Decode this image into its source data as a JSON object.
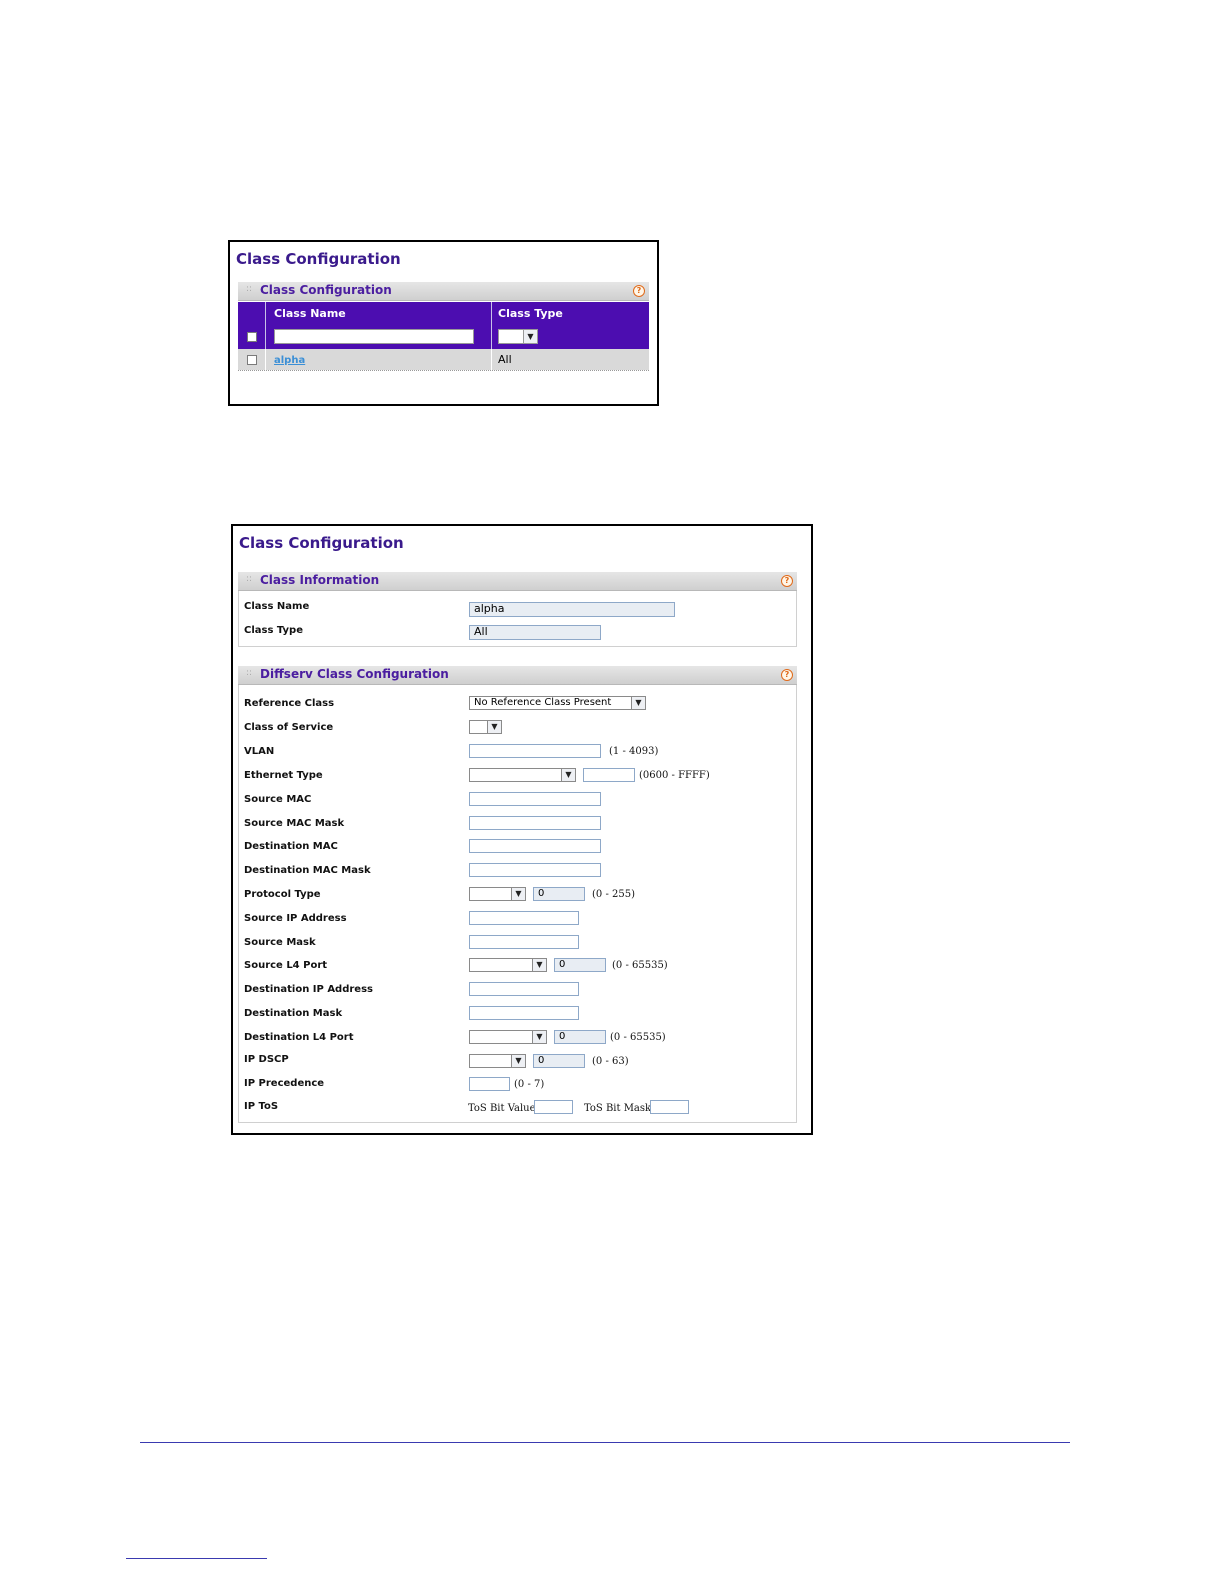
{
  "screen1": {
    "title": "Class Configuration",
    "section_title": "Class Configuration",
    "help": "?",
    "table": {
      "headers": [
        "Class Name",
        "Class Type"
      ],
      "rows": [
        {
          "name": "alpha",
          "type": "All"
        }
      ]
    }
  },
  "screen2": {
    "title": "Class Configuration",
    "help": "?",
    "info": {
      "section_title": "Class Information",
      "class_name_label": "Class Name",
      "class_name_value": "alpha",
      "class_type_label": "Class Type",
      "class_type_value": "All"
    },
    "diffserv": {
      "section_title": "Diffserv Class Configuration",
      "reference_class": {
        "label": "Reference Class",
        "value": "No Reference Class Present"
      },
      "class_of_service": {
        "label": "Class of Service"
      },
      "vlan": {
        "label": "VLAN",
        "range": "(1 - 4093)"
      },
      "ethernet_type": {
        "label": "Ethernet Type",
        "range": "(0600 - FFFF)"
      },
      "source_mac": {
        "label": "Source MAC"
      },
      "source_mac_mask": {
        "label": "Source MAC Mask"
      },
      "destination_mac": {
        "label": "Destination MAC"
      },
      "destination_mac_mask": {
        "label": "Destination MAC Mask"
      },
      "protocol_type": {
        "label": "Protocol Type",
        "value": "0",
        "range": "(0 - 255)"
      },
      "source_ip": {
        "label": "Source IP Address"
      },
      "source_mask": {
        "label": "Source Mask"
      },
      "source_l4_port": {
        "label": "Source L4 Port",
        "value": "0",
        "range": "(0 - 65535)"
      },
      "destination_ip": {
        "label": "Destination IP Address"
      },
      "destination_mask": {
        "label": "Destination Mask"
      },
      "destination_l4_port": {
        "label": "Destination L4 Port",
        "value": "0",
        "range": "(0 - 65535)"
      },
      "ip_dscp": {
        "label": "IP DSCP",
        "value": "0",
        "range": "(0 - 63)"
      },
      "ip_precedence": {
        "label": "IP Precedence",
        "range": "(0 - 7)"
      },
      "ip_tos": {
        "label": "IP ToS",
        "tos_bit_value": "ToS Bit Value",
        "tos_bit_mask": "ToS Bit Mask"
      }
    }
  },
  "icons": {
    "dropdown": "chevron-down-icon",
    "help": "help-icon",
    "drag": "drag-handle-icon"
  },
  "colors": {
    "title": "#3a1a8c",
    "table_header": "#4c0db0",
    "link": "#3b8fd6",
    "help": "#e06a1a"
  }
}
